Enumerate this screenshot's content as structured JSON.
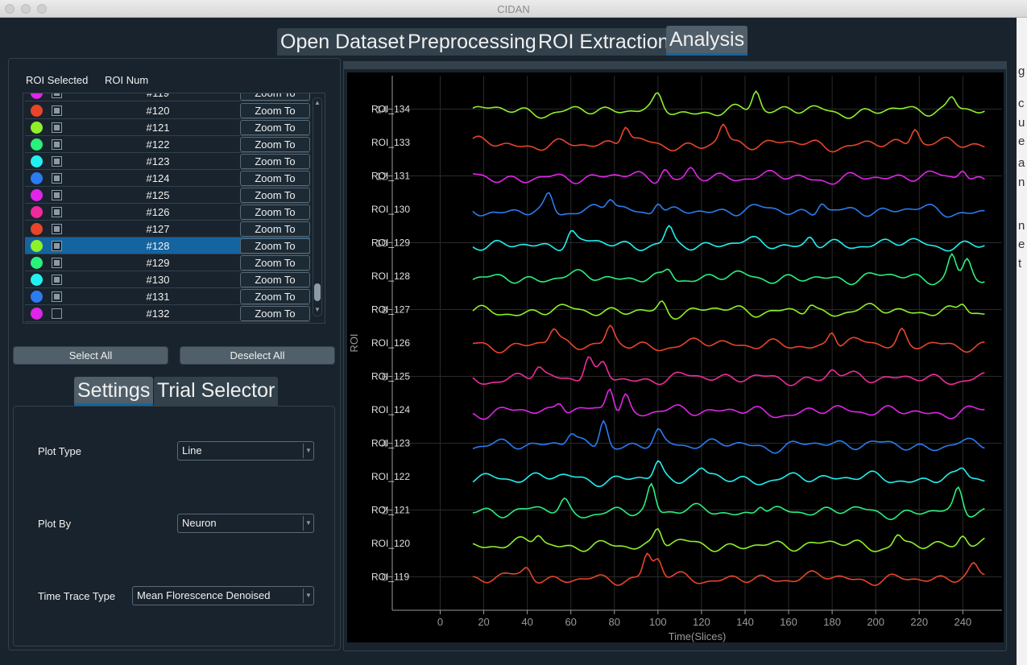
{
  "window": {
    "title": "CIDAN"
  },
  "main_tabs": [
    "Open Dataset",
    "Preprocessing",
    "ROI Extraction",
    "Analysis"
  ],
  "roi_table": {
    "headers": [
      "ROI Selected",
      "ROI Num"
    ],
    "partial_top_row": "#119",
    "rows": [
      {
        "num": "#120",
        "color": "#e8452a",
        "checked": true,
        "selected": false,
        "action": "Zoom To"
      },
      {
        "num": "#121",
        "color": "#8ff02a",
        "checked": true,
        "selected": false,
        "action": "Zoom To"
      },
      {
        "num": "#122",
        "color": "#2af07c",
        "checked": true,
        "selected": false,
        "action": "Zoom To"
      },
      {
        "num": "#123",
        "color": "#22f0f0",
        "checked": true,
        "selected": false,
        "action": "Zoom To"
      },
      {
        "num": "#124",
        "color": "#2a7cf0",
        "checked": true,
        "selected": false,
        "action": "Zoom To"
      },
      {
        "num": "#125",
        "color": "#e025e8",
        "checked": true,
        "selected": false,
        "action": "Zoom To"
      },
      {
        "num": "#126",
        "color": "#f02a9c",
        "checked": true,
        "selected": false,
        "action": "Zoom To"
      },
      {
        "num": "#127",
        "color": "#e8452a",
        "checked": true,
        "selected": false,
        "action": "Zoom To"
      },
      {
        "num": "#128",
        "color": "#8ff02a",
        "checked": true,
        "selected": true,
        "action": "Zoom To"
      },
      {
        "num": "#129",
        "color": "#2af07c",
        "checked": true,
        "selected": false,
        "action": "Zoom To"
      },
      {
        "num": "#130",
        "color": "#22f0f0",
        "checked": true,
        "selected": false,
        "action": "Zoom To"
      },
      {
        "num": "#131",
        "color": "#2a7cf0",
        "checked": true,
        "selected": false,
        "action": "Zoom To"
      },
      {
        "num": "#132",
        "color": "#e025e8",
        "checked": false,
        "selected": false,
        "action": "Zoom To"
      }
    ]
  },
  "buttons": {
    "select_all": "Select All",
    "deselect_all": "Deselect All"
  },
  "sub_tabs": [
    "Settings",
    "Trial Selector"
  ],
  "settings": {
    "plot_type": {
      "label": "Plot Type",
      "value": "Line"
    },
    "plot_by": {
      "label": "Plot By",
      "value": "Neuron"
    },
    "time_trace_type": {
      "label": "Time Trace Type",
      "value": "Mean Florescence Denoised"
    }
  },
  "chart_data": {
    "type": "line",
    "title": "",
    "xlabel": "Time(Slices)",
    "ylabel": "ROI",
    "xlim": [
      -22,
      258
    ],
    "ylim": [
      -1,
      15
    ],
    "xticks": [
      0,
      20,
      40,
      60,
      80,
      100,
      120,
      140,
      160,
      180,
      200,
      220,
      240
    ],
    "yticks": [
      0,
      2,
      4,
      6,
      8,
      10,
      12,
      14
    ],
    "grid": true,
    "legend": "none",
    "series": [
      {
        "name": "ROI_119",
        "offset": 0,
        "color": "#e8452a",
        "peaks": [
          [
            95,
            0.7
          ],
          [
            100,
            0.5
          ],
          [
            245,
            0.3
          ],
          [
            40,
            0.25
          ]
        ]
      },
      {
        "name": "ROI_120",
        "offset": 1,
        "color": "#8ff02a",
        "peaks": [
          [
            100,
            0.5
          ],
          [
            45,
            0.3
          ],
          [
            210,
            0.35
          ],
          [
            240,
            0.3
          ]
        ]
      },
      {
        "name": "ROI_121",
        "offset": 2,
        "color": "#2af07c",
        "peaks": [
          [
            97,
            0.8
          ],
          [
            238,
            0.65
          ],
          [
            57,
            0.3
          ],
          [
            147,
            0.3
          ]
        ]
      },
      {
        "name": "ROI_122",
        "offset": 3,
        "color": "#22f0f0",
        "peaks": [
          [
            100,
            0.45
          ],
          [
            240,
            0.25
          ],
          [
            120,
            0.2
          ]
        ]
      },
      {
        "name": "ROI_123",
        "offset": 4,
        "color": "#2a7cf0",
        "peaks": [
          [
            75,
            0.85
          ],
          [
            60,
            0.3
          ],
          [
            100,
            0.35
          ]
        ]
      },
      {
        "name": "ROI_124",
        "offset": 5,
        "color": "#e025e8",
        "peaks": [
          [
            78,
            0.8
          ],
          [
            85,
            0.55
          ],
          [
            55,
            0.3
          ]
        ]
      },
      {
        "name": "ROI_125",
        "offset": 6,
        "color": "#f02a9c",
        "peaks": [
          [
            68,
            0.6
          ],
          [
            75,
            0.4
          ],
          [
            45,
            0.3
          ],
          [
            180,
            0.2
          ]
        ]
      },
      {
        "name": "ROI_126",
        "offset": 7,
        "color": "#e8452a",
        "peaks": [
          [
            78,
            0.5
          ],
          [
            52,
            0.4
          ],
          [
            180,
            0.45
          ],
          [
            212,
            0.4
          ]
        ]
      },
      {
        "name": "ROI_127",
        "offset": 8,
        "color": "#8ff02a",
        "peaks": [
          [
            102,
            0.3
          ],
          [
            170,
            0.25
          ],
          [
            240,
            0.3
          ]
        ]
      },
      {
        "name": "ROI_128",
        "offset": 9,
        "color": "#2af07c",
        "peaks": [
          [
            105,
            0.3
          ],
          [
            235,
            0.7
          ],
          [
            242,
            0.5
          ]
        ]
      },
      {
        "name": "ROI_129",
        "offset": 10,
        "color": "#22f0f0",
        "peaks": [
          [
            105,
            0.5
          ],
          [
            60,
            0.35
          ],
          [
            170,
            0.25
          ]
        ]
      },
      {
        "name": "ROI_130",
        "offset": 11,
        "color": "#2a7cf0",
        "peaks": [
          [
            50,
            0.5
          ],
          [
            78,
            0.35
          ],
          [
            100,
            0.4
          ],
          [
            175,
            0.35
          ]
        ]
      },
      {
        "name": "ROI_131",
        "offset": 12,
        "color": "#e025e8",
        "peaks": [
          [
            103,
            0.35
          ],
          [
            240,
            0.35
          ],
          [
            115,
            0.25
          ]
        ]
      },
      {
        "name": "ROI_133",
        "offset": 13,
        "color": "#e8452a",
        "peaks": [
          [
            85,
            0.55
          ],
          [
            130,
            0.55
          ],
          [
            218,
            0.5
          ]
        ]
      },
      {
        "name": "ROI_134",
        "offset": 14,
        "color": "#8ff02a",
        "peaks": [
          [
            145,
            0.6
          ],
          [
            100,
            0.35
          ],
          [
            235,
            0.35
          ]
        ]
      }
    ]
  }
}
